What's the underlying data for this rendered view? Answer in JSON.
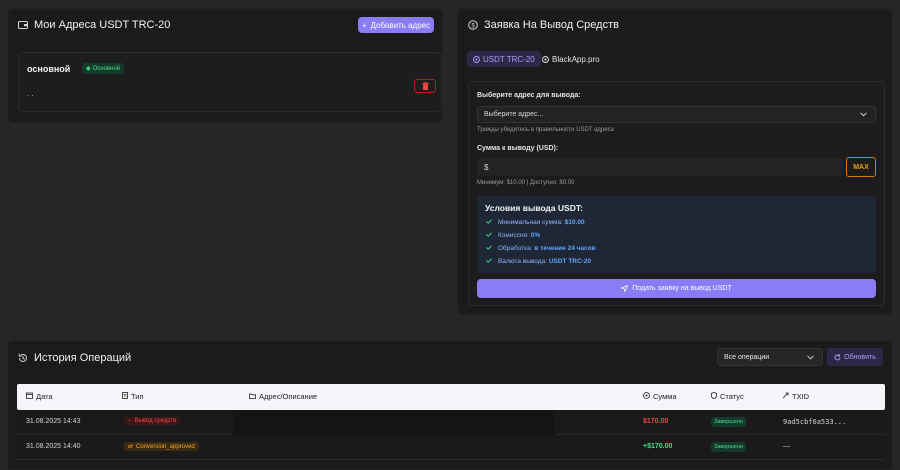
{
  "addresses": {
    "title": "Мои Адреса USDT TRC-20",
    "add_button": "Добавить адрес",
    "card": {
      "name": "основной",
      "badge": "Основной",
      "address": ". ."
    }
  },
  "withdraw": {
    "title": "Заявка На Вывод Средств",
    "tabs": [
      {
        "label": "USDT TRC-20",
        "active": true
      },
      {
        "label": "BlackApp.pro",
        "active": false
      }
    ],
    "address_label": "Выберите адрес для вывода:",
    "address_placeholder": "Выберите адрес...",
    "address_hint": "Трижды убедитесь в правильности USDT адреса",
    "amount_label": "Сумма к выводу (USD):",
    "amount_prefix": "$",
    "max_label": "MAX",
    "amount_hint": "Минимум: $10.00 | Доступно: $0.00",
    "conditions": {
      "title": "Условия вывода USDT:",
      "items": [
        {
          "label": "Минимальная сумма:",
          "value": "$10.00"
        },
        {
          "label": "Комиссия:",
          "value": "0%"
        },
        {
          "label": "Обработка:",
          "value": "в течение 24 часов"
        },
        {
          "label": "Валюта вывода:",
          "value": "USDT TRC-20"
        }
      ]
    },
    "submit_label": "Подать заявку на вывод USDT"
  },
  "history": {
    "title": "История Операций",
    "filter_value": "Все операции",
    "refresh_label": "Обновить",
    "columns": {
      "date": "Дата",
      "type": "Тип",
      "desc": "Адрес/Описание",
      "amount": "Сумма",
      "status": "Статус",
      "txid": "TXID"
    },
    "rows": [
      {
        "date": "31.08.2025 14:43",
        "type": "Вывод средств",
        "amount": "$170.00",
        "status": "Завершено",
        "txid": "9ad5cbf6a533..."
      },
      {
        "date": "31.08.2025 14:40",
        "type": "Conversion_approved",
        "amount": "+$170.00",
        "status": "Завершено",
        "txid": "—"
      }
    ]
  },
  "colors": {
    "accent": "#8b7cf6",
    "success": "#4ade80",
    "danger": "#ef4444",
    "warning": "#f59e0b"
  },
  "icons": [
    "wallet-icon",
    "plus-icon",
    "trash-icon",
    "dollar-icon",
    "check-icon",
    "send-icon",
    "history-icon",
    "refresh-icon",
    "calendar-icon",
    "list-icon",
    "folder-icon",
    "coin-icon",
    "shield-icon",
    "link-icon",
    "chevron-down-icon"
  ]
}
